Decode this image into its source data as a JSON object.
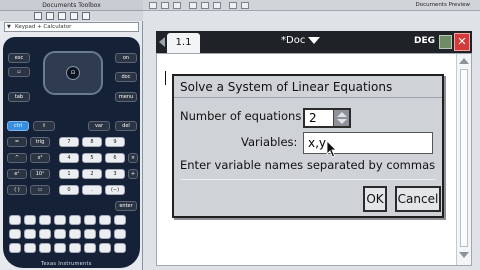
{
  "toolbox": {
    "title": "Documents Toolbox",
    "dropdown": "Keypad + Calculator"
  },
  "doc_strip": {
    "preview_label": "Documents Preview"
  },
  "doc": {
    "page_tab": "1.1",
    "title": "*Doc",
    "angle_mode": "DEG"
  },
  "dialog": {
    "title": "Solve a System of Linear Equations",
    "num_eq_label": "Number of equations",
    "num_eq_value": "2",
    "variables_label": "Variables:",
    "variables_value": "x,y",
    "hint": "Enter variable names separated by commas",
    "ok_label": "OK",
    "cancel_label": "Cancel"
  },
  "keypad": {
    "rows": [
      [
        "7",
        "8",
        "9",
        "×",
        "÷"
      ],
      [
        "4",
        "5",
        "6",
        "+",
        "−"
      ],
      [
        "1",
        "2",
        "3",
        "",
        ""
      ],
      [
        "0",
        ".",
        "(−)",
        "enter",
        ""
      ]
    ],
    "top_left": [
      "esc",
      "tab"
    ],
    "top_right": [
      "on",
      "doc",
      "menu"
    ],
    "mid": [
      "ctrl",
      "shift",
      "var",
      "del"
    ],
    "brand": "Texas Instruments"
  }
}
